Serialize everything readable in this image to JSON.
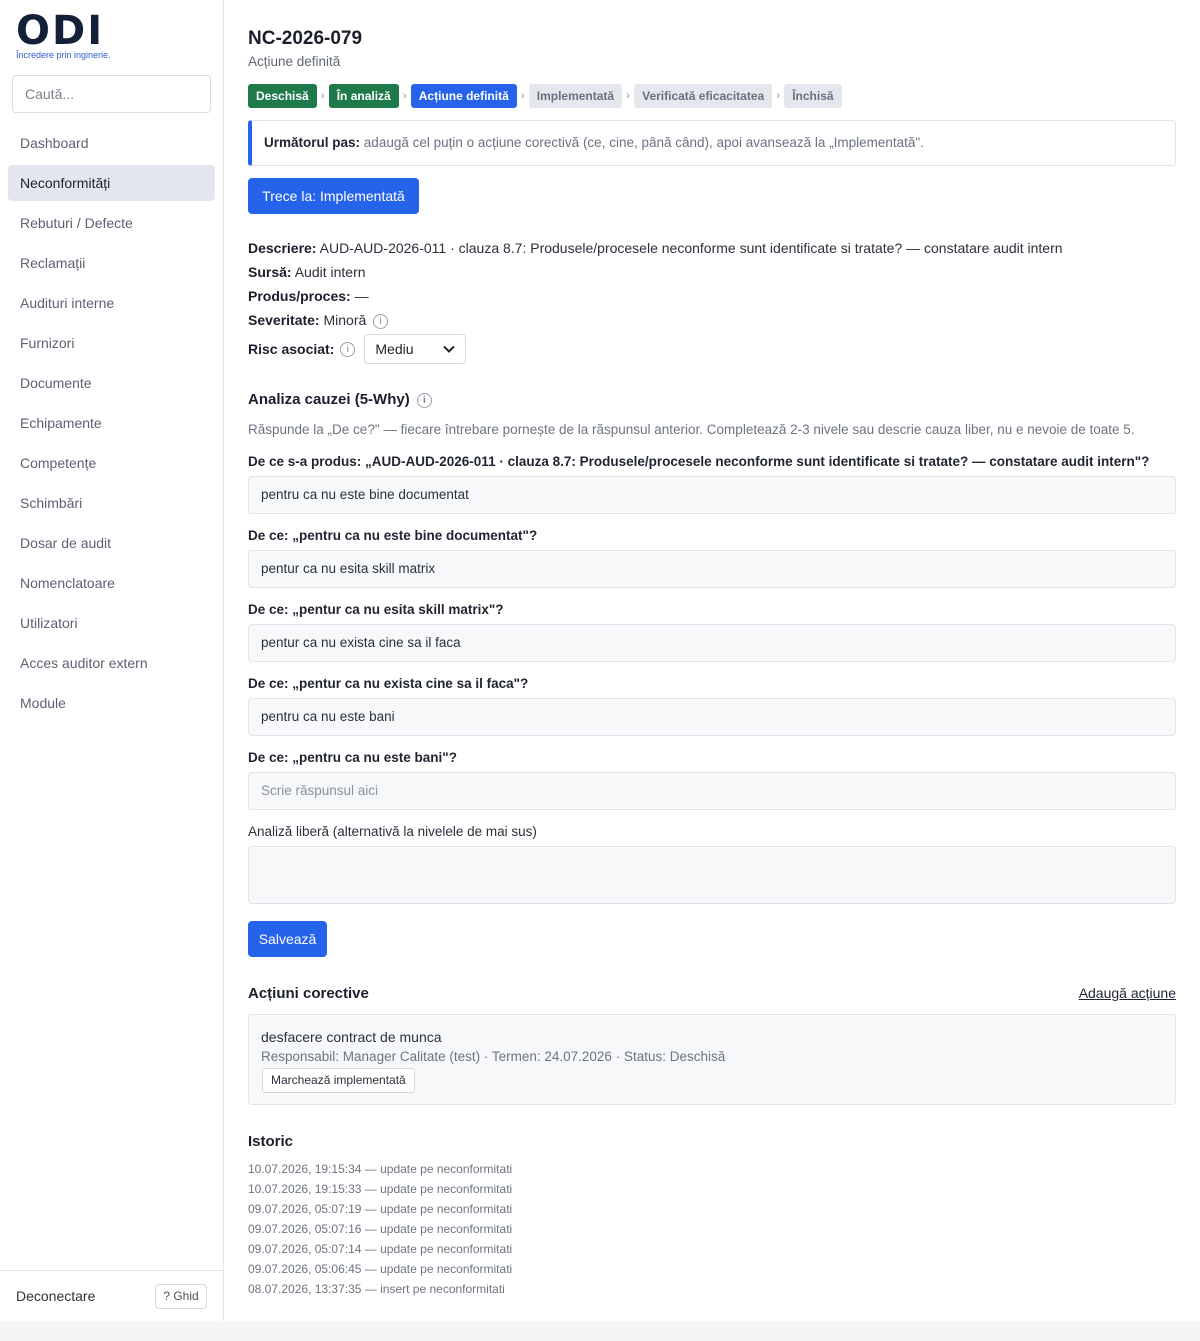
{
  "brand": {
    "logo_text": "ODI",
    "tagline": "Încredere prin inginerie."
  },
  "search": {
    "placeholder": "Caută..."
  },
  "sidebar": {
    "items": [
      {
        "label": "Dashboard",
        "active": false
      },
      {
        "label": "Neconformități",
        "active": true
      },
      {
        "label": "Rebuturi / Defecte",
        "active": false
      },
      {
        "label": "Reclamații",
        "active": false
      },
      {
        "label": "Audituri interne",
        "active": false
      },
      {
        "label": "Furnizori",
        "active": false
      },
      {
        "label": "Documente",
        "active": false
      },
      {
        "label": "Echipamente",
        "active": false
      },
      {
        "label": "Competențe",
        "active": false
      },
      {
        "label": "Schimbări",
        "active": false
      },
      {
        "label": "Dosar de audit",
        "active": false
      },
      {
        "label": "Nomenclatoare",
        "active": false
      },
      {
        "label": "Utilizatori",
        "active": false
      },
      {
        "label": "Acces auditor extern",
        "active": false
      },
      {
        "label": "Module",
        "active": false
      }
    ],
    "logout": "Deconectare",
    "guide": "? Ghid"
  },
  "record": {
    "id": "NC-2026-079",
    "status": "Acțiune definită"
  },
  "workflow": {
    "steps": [
      {
        "label": "Deschisă",
        "state": "done"
      },
      {
        "label": "În analiză",
        "state": "done"
      },
      {
        "label": "Acțiune definită",
        "state": "current"
      },
      {
        "label": "Implementată",
        "state": "todo"
      },
      {
        "label": "Verificată eficacitatea",
        "state": "todo"
      },
      {
        "label": "Închisă",
        "state": "todo"
      }
    ],
    "separator": "›"
  },
  "next_step": {
    "label": "Următorul pas:",
    "text": "adaugă cel puțin o acțiune corectivă (ce, cine, până când), apoi avansează la „Implementată\"."
  },
  "advance_button": "Trece la: Implementată",
  "details": {
    "description_label": "Descriere:",
    "description": "AUD-AUD-2026-011 · clauza 8.7: Produsele/procesele neconforme sunt identificate si tratate? — constatare audit intern",
    "source_label": "Sursă:",
    "source": "Audit intern",
    "product_label": "Produs/proces:",
    "product": "—",
    "severity_label": "Severitate:",
    "severity": "Minoră",
    "risk_label": "Risc asociat:",
    "risk": "Mediu",
    "info_glyph": "i"
  },
  "root_cause": {
    "title": "Analiza cauzei (5-Why)",
    "help": "Răspunde la „De ce?\" — fiecare întrebare pornește de la răspunsul anterior. Completează 2-3 nivele sau descrie cauza liber, nu e nevoie de toate 5.",
    "whys": [
      {
        "question": "De ce s-a produs: „AUD-AUD-2026-011 · clauza 8.7: Produsele/procesele neconforme sunt identificate si tratate? — constatare audit intern\"?",
        "answer": "pentru ca nu este bine documentat"
      },
      {
        "question": "De ce: „pentru ca nu este bine documentat\"?",
        "answer": "pentur ca nu esita skill matrix"
      },
      {
        "question": "De ce: „pentur ca nu esita skill matrix\"?",
        "answer": "pentur ca nu exista cine sa il faca"
      },
      {
        "question": "De ce: „pentur ca nu exista cine sa il faca\"?",
        "answer": "pentru ca nu este bani"
      },
      {
        "question": "De ce: „pentru ca nu este bani\"?",
        "answer": "",
        "placeholder": "Scrie răspunsul aici"
      }
    ],
    "free_label": "Analiză liberă (alternativă la nivelele de mai sus)",
    "free_value": "",
    "save_label": "Salvează"
  },
  "corrective_actions": {
    "title": "Acțiuni corective",
    "add_label": "Adaugă acțiune",
    "items": [
      {
        "name": "desfacere contract de munca",
        "meta": "Responsabil: Manager Calitate (test) · Termen: 24.07.2026 · Status: Deschisă",
        "button": "Marchează implementată"
      }
    ]
  },
  "history": {
    "title": "Istoric",
    "entries": [
      "10.07.2026, 19:15:34 — update pe neconformitati",
      "10.07.2026, 19:15:33 — update pe neconformitati",
      "09.07.2026, 05:07:19 — update pe neconformitati",
      "09.07.2026, 05:07:16 — update pe neconformitati",
      "09.07.2026, 05:07:14 — update pe neconformitati",
      "09.07.2026, 05:06:45 — update pe neconformitati",
      "08.07.2026, 13:37:35 — insert pe neconformitati"
    ]
  },
  "colors": {
    "primary": "#2563eb",
    "done_step": "#1f7a4b",
    "todo_step": "#e4e7ec",
    "active_nav": "#e3e6ed"
  }
}
